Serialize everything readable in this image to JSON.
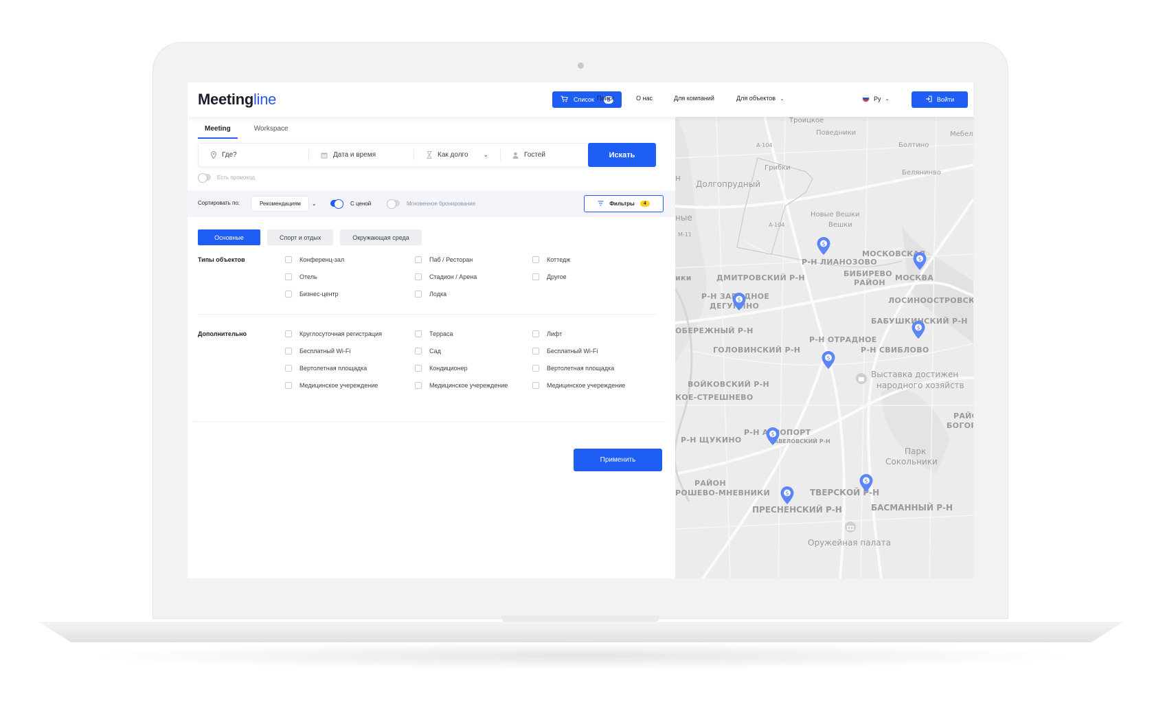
{
  "header": {
    "logo_part1": "Meeting",
    "logo_part2": "line",
    "list_button": "Список",
    "list_count": "8",
    "nav": [
      "Поиск",
      "О нас",
      "Для компаний",
      "Для объектов"
    ],
    "lang": "Ру",
    "login": "Войти"
  },
  "tabs": [
    "Meeting",
    "Workspace"
  ],
  "search": {
    "where": "Где?",
    "date": "Дата и время",
    "duration": "Как долго",
    "guests": "Гостей",
    "button": "Искать",
    "promo": "Есть промокод"
  },
  "sort": {
    "label": "Сортировать по:",
    "value": "Рекомендациям",
    "with_price": "С ценой",
    "instant": "Мгновенное бронирование",
    "filters": "Фильтры",
    "filters_count": "4"
  },
  "categories": [
    "Основные",
    "Спорт и отдых",
    "Окружающая среда"
  ],
  "types": {
    "title": "Типы объектов",
    "items": [
      "Конференц-зал",
      "Паб / Ресторан",
      "Коттедж",
      "Отель",
      "Стадион / Арена",
      "Другое",
      "Бизнес-центр",
      "Лодка"
    ]
  },
  "extra": {
    "title": "Дополнительно",
    "items": [
      "Круглосуточная регистрация",
      "Терраса",
      "Лифт",
      "Бесплатный Wi-Fi",
      "Сад",
      "Бесплатный Wi-Fi",
      "Вертолетная площадка",
      "Кондиционер",
      "Вертолетная площадка",
      "Медицинское учереждение",
      "Медицинское учереждение",
      "Медицинское учереждение"
    ]
  },
  "apply": "Применить",
  "map": {
    "labels": [
      "Троицкое",
      "Поведники",
      "Мебел фабр",
      "Болтино",
      "Грибки",
      "Белянинво",
      "Долгопрудный",
      "A-104",
      "A-104",
      "M-11",
      "Новые Вешки",
      "Вешки",
      "Р-Н ЛИАНОЗОВО",
      "МОСКОВСКАЯ",
      "БИБИРЕВО",
      "РАЙОН",
      "МОСКВА",
      "ДМИТРОВСКИЙ Р-Н",
      "Р-Н ЗАПАДНОЕ",
      "ДЕГУНИНО",
      "ЛОСИНООСТРОВСКИЙ",
      "БАБУШКИНСКИЙ Р-Н",
      "ОБЕРЕЖНЫЙ Р-Н",
      "Р-Н ОТРАДНОЕ",
      "ГОЛОВИНСКИЙ Р-Н",
      "Р-Н СВИБЛОВО",
      "Выставка достижен",
      "народного хозяйств",
      "ВОЙКОВСКИЙ Р-Н",
      "КОЕ-СТРЕШНЕВО",
      "РАЙО",
      "БОГОРОД",
      "Р-Н АЭРОПОРТ",
      "САВЕЛОВСКИЙ Р-Н",
      "Р-Н ЩУКИНО",
      "Парк",
      "Сокольники",
      "РАЙОН",
      "РОШЕВО-МНЕВНИКИ",
      "ТВЕРСКОЙ Р-Н",
      "ПРЕСНЕНСКИЙ Р-Н",
      "БАСМАННЫЙ Р-Н",
      "Оружейная палата",
      "ики",
      "ные",
      "н"
    ]
  },
  "colors": {
    "accent": "#1f5ef5",
    "badge": "#ffcf24",
    "pin": "#5b86f7"
  }
}
